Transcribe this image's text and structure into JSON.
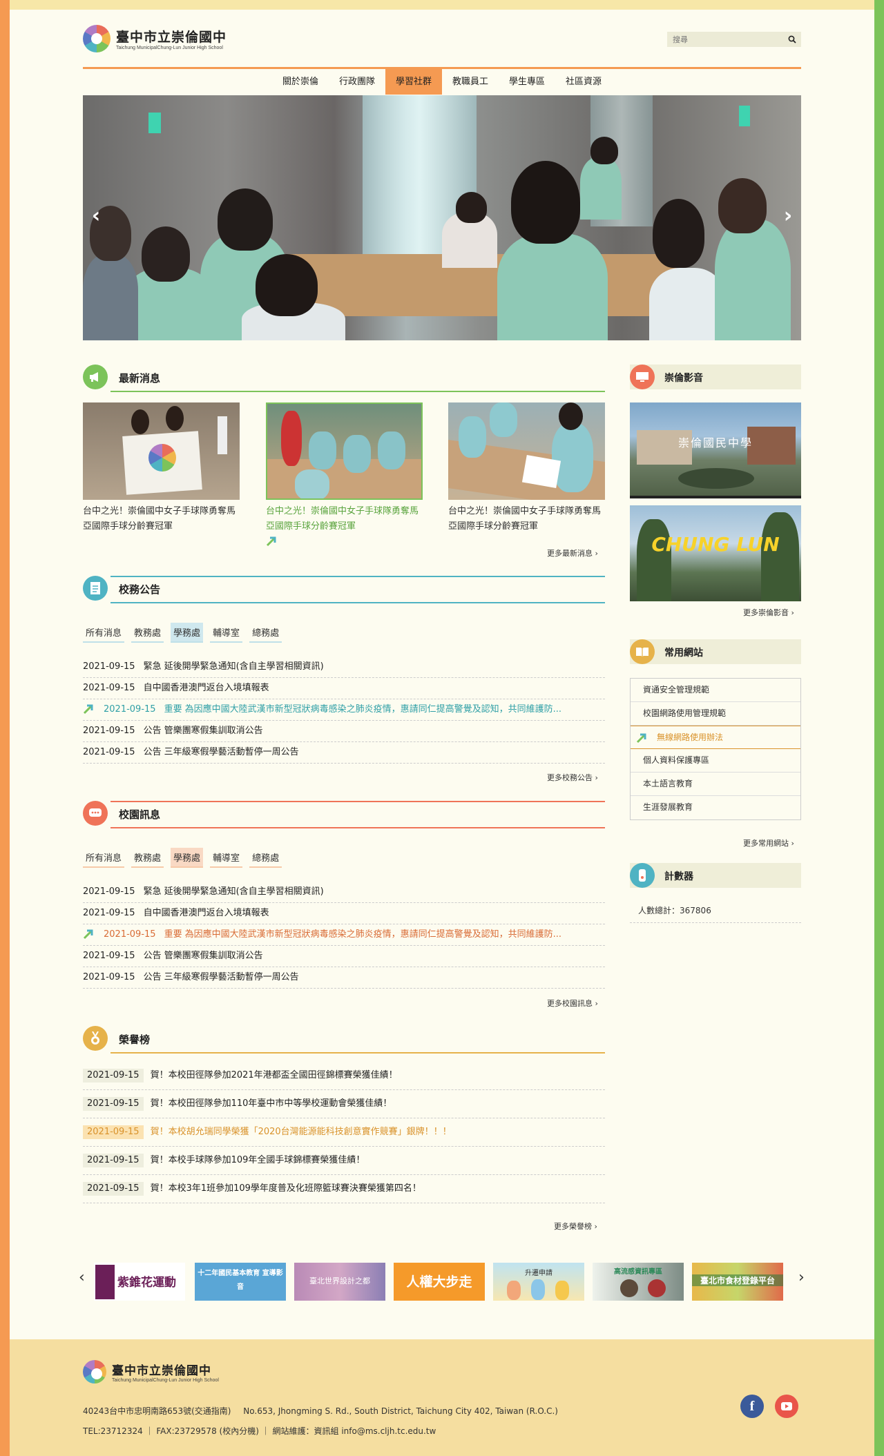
{
  "site": {
    "name_cn": "臺中市立崇倫國中",
    "name_en": "Taichung MunicipalChung-Lun Junior High School"
  },
  "search": {
    "placeholder": "搜尋"
  },
  "nav": {
    "items": [
      "關於崇倫",
      "行政團隊",
      "學習社群",
      "教職員工",
      "學生專區",
      "社區資源"
    ],
    "active": "學習社群"
  },
  "news": {
    "title": "最新消息",
    "cards": [
      {
        "text": "台中之光！崇倫國中女子手球隊勇奪馬亞國際手球分齡賽冠軍"
      },
      {
        "text": "台中之光！崇倫國中女子手球隊勇奪馬亞國際手球分齡賽冠軍"
      },
      {
        "text": "台中之光！崇倫國中女子手球隊勇奪馬亞國際手球分齡賽冠軍"
      }
    ],
    "more": "更多最新消息"
  },
  "announce": {
    "title": "校務公告",
    "tabs": [
      "所有消息",
      "教務處",
      "學務處",
      "輔導室",
      "總務處"
    ],
    "active_tab": "學務處",
    "rows": [
      {
        "date": "2021-09-15",
        "cat": "緊急",
        "text": "延後開學緊急通知(含自主學習相關資訊)"
      },
      {
        "date": "2021-09-15",
        "cat": "",
        "text": "自中國香港澳門返台入境填報表"
      },
      {
        "date": "2021-09-15",
        "cat": "重要",
        "text": "為因應中國大陸武漢市新型冠狀病毒感染之肺炎疫情，惠請同仁提高警覺及認知，共同維護防..."
      },
      {
        "date": "2021-09-15",
        "cat": "公告",
        "text": "管樂團寒假集訓取消公告"
      },
      {
        "date": "2021-09-15",
        "cat": "公告",
        "text": "三年級寒假學藝活動暫停一周公告"
      }
    ],
    "more": "更多校務公告"
  },
  "campus": {
    "title": "校園訊息",
    "tabs": [
      "所有消息",
      "教務處",
      "學務處",
      "輔導室",
      "總務處"
    ],
    "active_tab": "學務處",
    "rows": [
      {
        "date": "2021-09-15",
        "cat": "緊急",
        "text": "延後開學緊急通知(含自主學習相關資訊)"
      },
      {
        "date": "2021-09-15",
        "cat": "",
        "text": "自中國香港澳門返台入境填報表"
      },
      {
        "date": "2021-09-15",
        "cat": "重要",
        "text": "為因應中國大陸武漢市新型冠狀病毒感染之肺炎疫情，惠請同仁提高警覺及認知，共同維護防..."
      },
      {
        "date": "2021-09-15",
        "cat": "公告",
        "text": "管樂團寒假集訓取消公告"
      },
      {
        "date": "2021-09-15",
        "cat": "公告",
        "text": "三年級寒假學藝活動暫停一周公告"
      }
    ],
    "more": "更多校園訊息"
  },
  "honor": {
    "title": "榮譽榜",
    "rows": [
      {
        "date": "2021-09-15",
        "text": "賀！本校田徑隊參加2021年港都盃全國田徑錦標賽榮獲佳績！"
      },
      {
        "date": "2021-09-15",
        "text": "賀！本校田徑隊參加110年臺中市中等學校運動會榮獲佳績！"
      },
      {
        "date": "2021-09-15",
        "text": "賀！本校胡允瑞同學榮獲「2020台灣能源能科技創意實作競賽」銀牌！！！"
      },
      {
        "date": "2021-09-15",
        "text": "賀！本校手球隊參加109年全國手球錦標賽榮獲佳績！"
      },
      {
        "date": "2021-09-15",
        "text": "賀！本校3年1班參加109學年度普及化班際籃球賽決賽榮獲第四名！"
      }
    ],
    "more": "更多榮譽榜"
  },
  "video": {
    "title": "崇倫影音",
    "v1_caption": "崇倫國民中學",
    "v2_caption": "CHUNG LUN",
    "more": "更多崇倫影音"
  },
  "links": {
    "title": "常用網站",
    "items": [
      "資通安全管理規範",
      "校園網路使用管理規範",
      "無線網路使用辦法",
      "個人資料保護專區",
      "本土語言教育",
      "生涯發展教育"
    ],
    "active": "無線網路使用辦法",
    "more": "更多常用網站"
  },
  "counter": {
    "title": "計數器",
    "label": "人數總計：",
    "value": "367806"
  },
  "partners": [
    {
      "label": "紫錐花運動"
    },
    {
      "label": "十二年國民基本教育 宣導影音"
    },
    {
      "label": "臺北世界設計之都"
    },
    {
      "label": "人權大步走"
    },
    {
      "label": "升遷申請"
    },
    {
      "label": "高流感資訊專區"
    },
    {
      "label": "臺北市食材登錄平台"
    }
  ],
  "footer": {
    "address_cn": "40243台中市忠明南路653號(交通指南)",
    "address_en": "No.653, Jhongming S. Rd., South District, Taichung City 402, Taiwan (R.O.C.)",
    "contact": "TEL:23712324 ｜ FAX:23729578 (校內分機) ｜ 網站維護：資訊組 info@ms.cljh.tc.edu.tw"
  },
  "colors": {
    "orange": "#f59a52",
    "green": "#7cc35a",
    "teal": "#4fb3c3",
    "coral": "#ef7358",
    "gold": "#e6b24a",
    "footer": "#f5dea0"
  }
}
